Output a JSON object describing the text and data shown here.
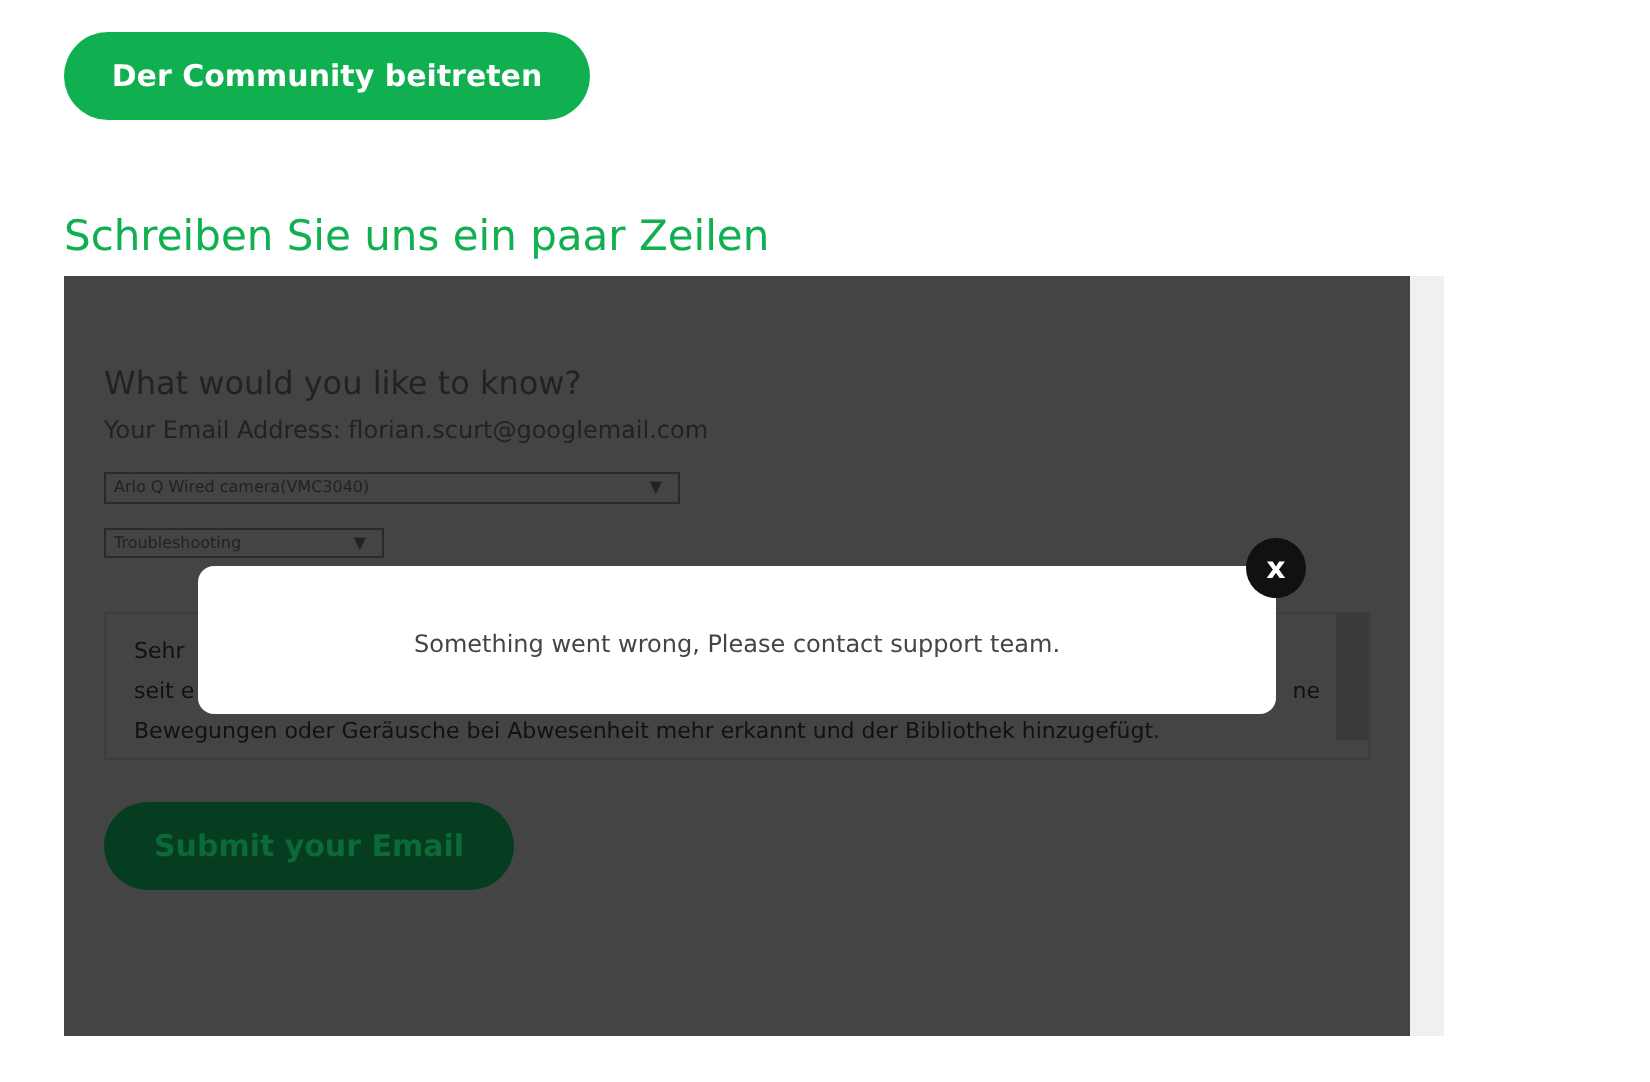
{
  "join_button": {
    "label": "Der Community beitreten"
  },
  "section_title": "Schreiben Sie uns ein paar Zeilen",
  "form": {
    "heading": "What would you like to know?",
    "email_line": "Your Email Address: florian.scurt@googlemail.com",
    "product_select": {
      "value": "Arlo Q Wired camera(VMC3040)",
      "arrow": "▼"
    },
    "topic_select": {
      "value": "Troubleshooting",
      "arrow": "▼"
    },
    "message_lines": [
      {
        "left": "Sehr"
      },
      {
        "left": "seit e",
        "right": "ne"
      },
      {
        "left": "Bewegungen oder Geräusche bei Abwesenheit mehr erkannt und der Bibliothek hinzugefügt."
      }
    ],
    "submit_button": {
      "label": "Submit your Email"
    }
  },
  "dialog": {
    "message": "Something went wrong, Please contact support team.",
    "close": "x"
  }
}
